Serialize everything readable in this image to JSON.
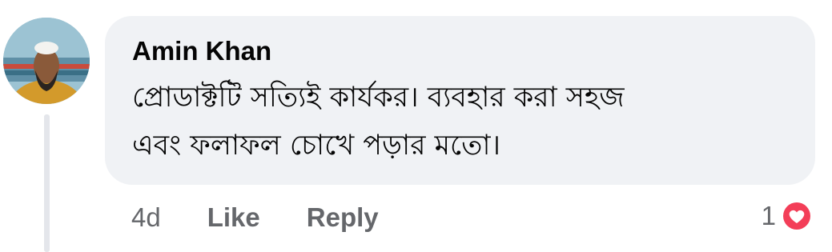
{
  "comment": {
    "author": "Amin Khan",
    "text_line_1": "প্রোডাক্টটি সত্যিই কার্যকর। ব্যবহার করা সহজ",
    "text_line_2": "এবং ফলাফল চোখে পড়ার মতো।",
    "timestamp": "4d",
    "like_label": "Like",
    "reply_label": "Reply",
    "reaction_count": "1",
    "reaction_icon": "love-reaction-icon"
  },
  "colors": {
    "bubble": "#f0f2f5",
    "text": "#050505",
    "secondary": "#65676b",
    "love": "#f33e58",
    "thread_line": "#e4e6eb"
  }
}
